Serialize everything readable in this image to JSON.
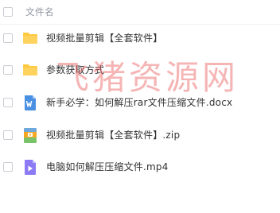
{
  "header": {
    "label": "文件名"
  },
  "files": [
    {
      "name": "视频批量剪辑【全套软件】",
      "type": "folder",
      "icon": "folder-icon"
    },
    {
      "name": "参数获取方式",
      "type": "folder",
      "icon": "folder-icon"
    },
    {
      "name": "新手必学：如何解压rar文件压缩文件.docx",
      "type": "word",
      "icon": "word-doc-icon"
    },
    {
      "name": "视频批量剪辑【全套软件】.zip",
      "type": "zip",
      "icon": "zip-archive-icon"
    },
    {
      "name": "电脑如何解压压缩文件.mp4",
      "type": "video",
      "icon": "video-file-icon"
    }
  ],
  "watermark": {
    "text": "飞猪资源网"
  },
  "colors": {
    "folder": "#ffc940",
    "word": "#4a90e2",
    "zip": "#f5a623",
    "video": "#8b7cf6",
    "watermark": "#eb5a5a"
  }
}
